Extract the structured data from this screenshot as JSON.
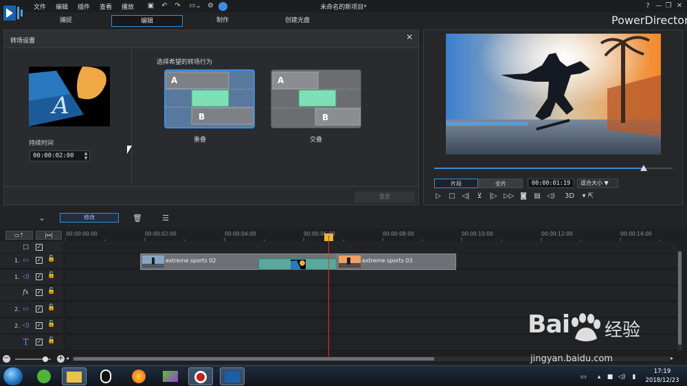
{
  "menu": [
    "文件",
    "编辑",
    "插件",
    "查看",
    "播放"
  ],
  "window_title": "未命名的新项目*",
  "window_controls": [
    "?",
    "—",
    "❐",
    "✕"
  ],
  "brand": "PowerDirector",
  "mode_tabs": [
    {
      "label": "捕捉",
      "active": false
    },
    {
      "label": "编辑",
      "active": true
    },
    {
      "label": "制作",
      "active": false
    },
    {
      "label": "创建光盘",
      "active": false
    }
  ],
  "transition_panel": {
    "title": "转场设置",
    "duration_label": "持续时间",
    "duration_value": "00:00:02:00",
    "choose_label": "选择希望的转场行为",
    "cards": [
      {
        "label": "重叠",
        "selected": true,
        "a": "A",
        "b": "B"
      },
      {
        "label": "交叠",
        "selected": false,
        "a": "A",
        "b": "B"
      }
    ],
    "reset_label": "重置"
  },
  "preview": {
    "seg_clip": "片段",
    "seg_full": "全片",
    "timecode": "00:00:01:19",
    "fit": "适合大小 ▼",
    "mode_3d": "3D",
    "playback_progress": 0.88
  },
  "toolbar": {
    "modify_label": "修改"
  },
  "ruler": [
    "00:00:00:00",
    "00:00:02:00",
    "00:00:04:00",
    "00:00:06:00",
    "00:00:08:00",
    "00:00:10:00",
    "00:00:12:00",
    "00:00:14:00"
  ],
  "tracks": [
    {
      "num": "",
      "icon": "□"
    },
    {
      "num": "1.",
      "icon": "▭"
    },
    {
      "num": "1.",
      "icon": "◁)"
    },
    {
      "num": "",
      "icon": "fx"
    },
    {
      "num": "2.",
      "icon": "▭"
    },
    {
      "num": "2.",
      "icon": "◁)"
    },
    {
      "num": "",
      "icon": "T"
    }
  ],
  "clips": [
    {
      "label": "extreme sports 02"
    },
    {
      "label": "extreme sports 03"
    }
  ],
  "taskbar": {
    "time": "17:19",
    "date": "2018/12/23"
  },
  "watermark": {
    "bai": "Bai",
    "du": "经验",
    "url": "jingyan.baidu.com"
  },
  "colors": {
    "accent": "#3b8ee0",
    "playhead": "#dd3333",
    "transition": "#5aa89b"
  }
}
